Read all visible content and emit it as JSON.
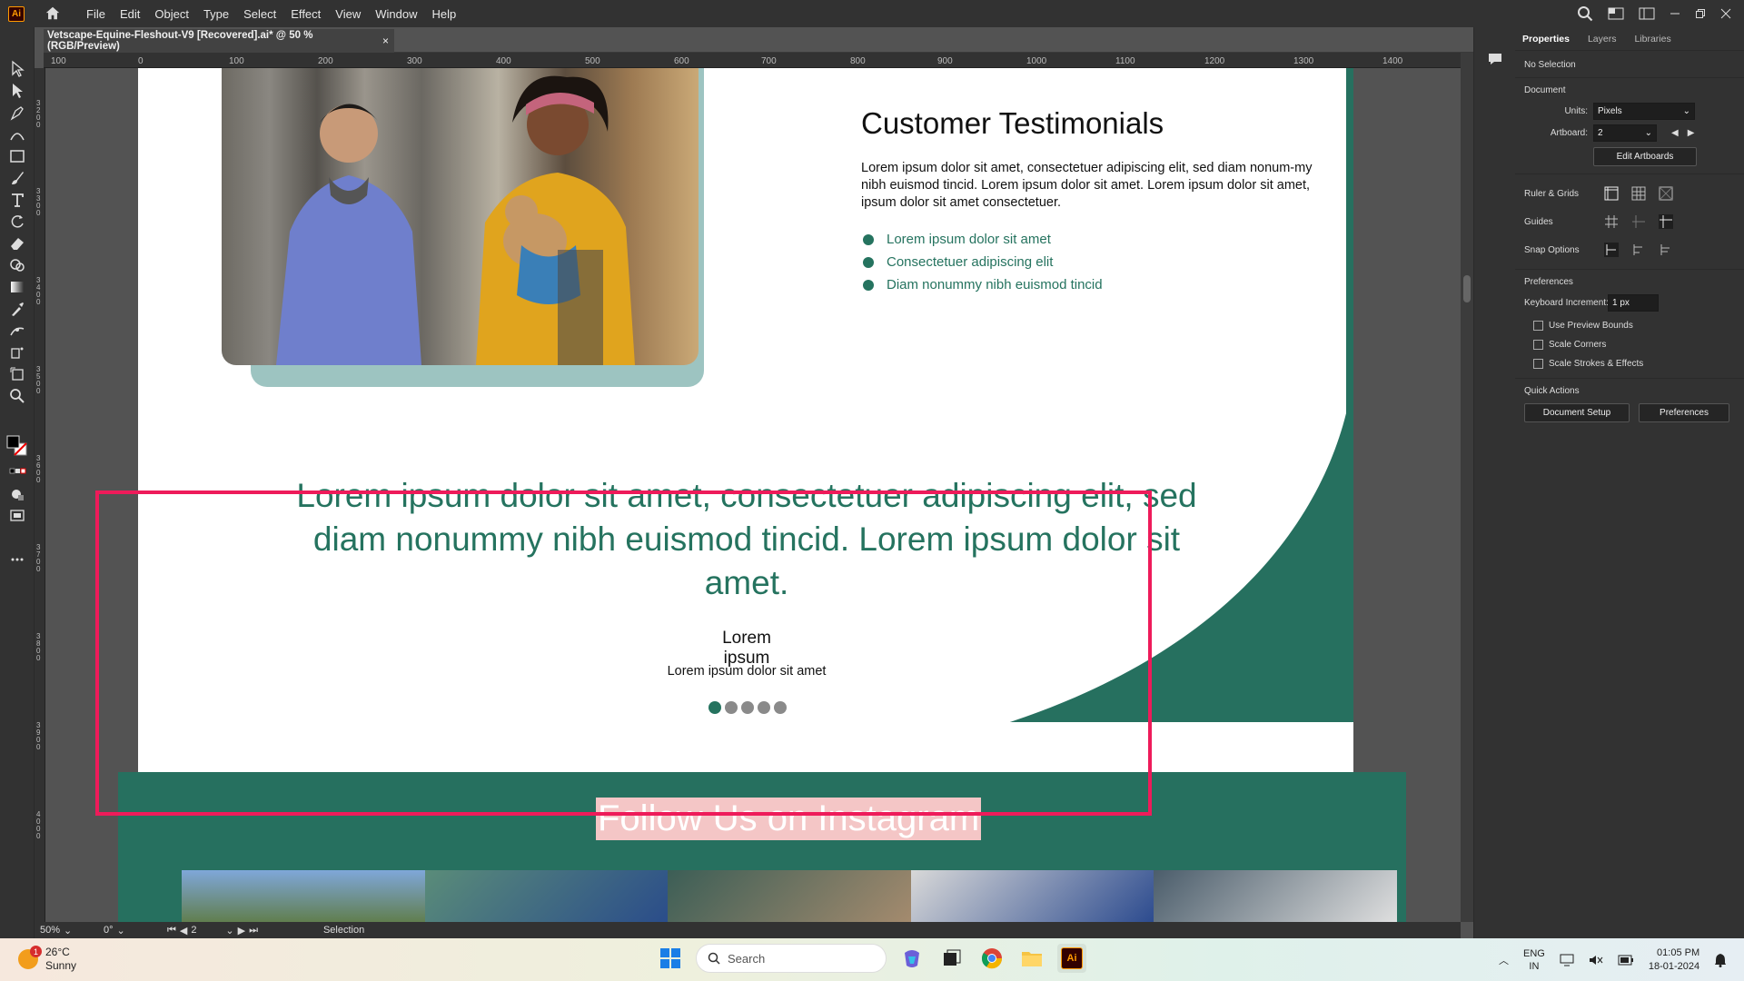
{
  "app": {
    "logo": "Ai",
    "menu": [
      "File",
      "Edit",
      "Object",
      "Type",
      "Select",
      "Effect",
      "View",
      "Window",
      "Help"
    ],
    "doc_tab": "Vetscape-Equine-Fleshout-V9 [Recovered].ai* @ 50 % (RGB/Preview)",
    "doc_tab_close": "×"
  },
  "ruler": {
    "top": [
      "100",
      "0",
      "100",
      "200",
      "300",
      "400",
      "500",
      "600",
      "700",
      "800",
      "900",
      "1000",
      "1100",
      "1200",
      "1300",
      "1400"
    ],
    "left": [
      "3200",
      "3300",
      "3400",
      "3500",
      "3600",
      "3700",
      "3800",
      "3900",
      "4000"
    ]
  },
  "artboard": {
    "heading": "Customer Testimonials",
    "intro": "Lorem ipsum dolor sit amet, consectetuer adipiscing elit, sed diam nonum-my nibh euismod tincid. Lorem ipsum dolor sit amet. Lorem ipsum dolor sit amet,  ipsum dolor sit amet consectetuer.",
    "bullets": [
      "Lorem ipsum dolor sit amet",
      "Consectetuer adipiscing elit",
      "Diam nonummy nibh euismod tincid"
    ],
    "quote": "Lorem ipsum dolor sit amet, consectetuer adipiscing elit, sed diam nonummy nibh euismod tincid. Lorem ipsum dolor sit amet.",
    "author": "Lorem ipsum",
    "author_sub": "Lorem ipsum dolor sit amet",
    "dots": {
      "count": 5,
      "active": 0
    },
    "insta_title": "Follow Us on Instagram",
    "colors": {
      "brand_green": "#25735f",
      "photo_frame": "#9dc4c1",
      "selection": "#ee1b5a",
      "insta_title_bg": "#f4c6c6"
    }
  },
  "status": {
    "zoom": "50%",
    "rotation": "0°",
    "artboard_num": "2",
    "tool": "Selection"
  },
  "panel": {
    "tabs": [
      "Properties",
      "Layers",
      "Libraries"
    ],
    "no_selection": "No Selection",
    "document_label": "Document",
    "units_label": "Units:",
    "units_value": "Pixels",
    "artboard_label": "Artboard:",
    "artboard_value": "2",
    "edit_artboards": "Edit Artboards",
    "ruler_grids": "Ruler & Grids",
    "guides": "Guides",
    "snap_options": "Snap Options",
    "preferences_label": "Preferences",
    "keyboard_increment_label": "Keyboard Increment:",
    "keyboard_increment_value": "1 px",
    "use_preview_bounds": "Use Preview Bounds",
    "scale_corners": "Scale Corners",
    "scale_strokes": "Scale Strokes & Effects",
    "quick_actions": "Quick Actions",
    "document_setup": "Document Setup",
    "preferences_btn": "Preferences"
  },
  "taskbar": {
    "temp": "26°C",
    "weather": "Sunny",
    "weather_badge": "1",
    "search_placeholder": "Search",
    "lang1": "ENG",
    "lang2": "IN",
    "time": "01:05 PM",
    "date": "18-01-2024"
  }
}
